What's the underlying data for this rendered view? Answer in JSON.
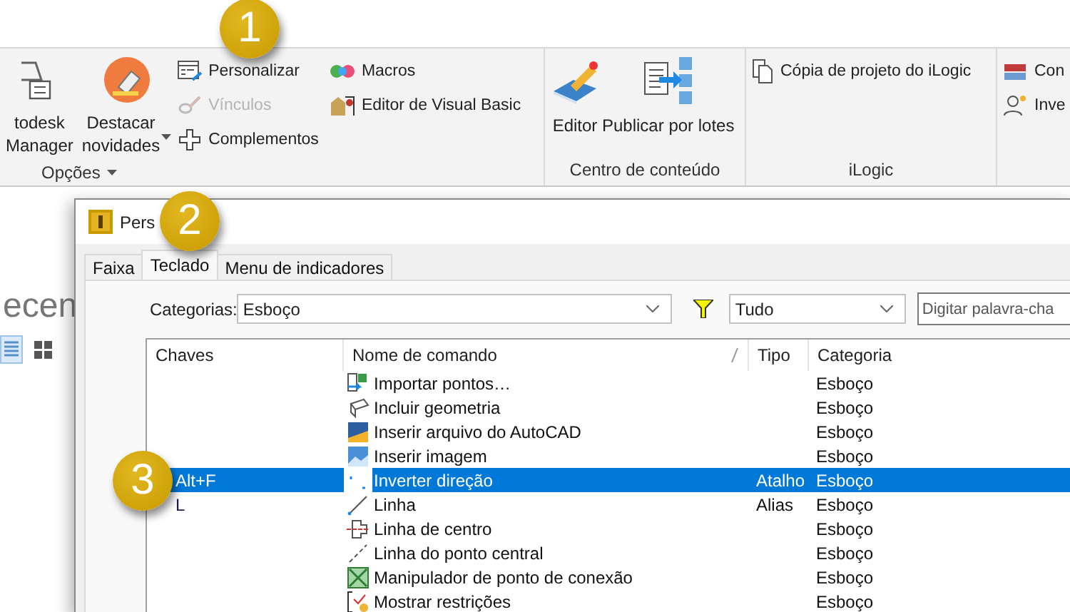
{
  "callouts": [
    {
      "label": "1"
    },
    {
      "label": "2"
    },
    {
      "label": "3"
    }
  ],
  "ribbon": {
    "panels": [
      {
        "title": "Opções",
        "has_menu": true,
        "items": [
          {
            "kind": "large",
            "label": "todesk\nManager",
            "dropdown": false
          },
          {
            "kind": "large",
            "label": "Destacar\nnovidades",
            "dropdown": true
          },
          {
            "kind": "small",
            "label": "Personalizar",
            "disabled": false
          },
          {
            "kind": "small",
            "label": "Vínculos",
            "disabled": true
          },
          {
            "kind": "small",
            "label": "Complementos",
            "disabled": false
          },
          {
            "kind": "small",
            "label": "Macros",
            "disabled": false
          },
          {
            "kind": "small",
            "label": "Editor de Visual Basic",
            "disabled": false
          }
        ]
      },
      {
        "title": "Centro de conteúdo",
        "has_menu": false,
        "items": [
          {
            "kind": "large",
            "label": "Editor",
            "dropdown": false
          },
          {
            "kind": "large",
            "label": "Publicar por lotes",
            "dropdown": false
          }
        ]
      },
      {
        "title": "iLogic",
        "has_menu": false,
        "items": [
          {
            "kind": "small",
            "label": "Cópia de projeto do iLogic",
            "disabled": false
          }
        ]
      },
      {
        "has_menu": false,
        "items": [
          {
            "kind": "small",
            "label": "Con",
            "disabled": false
          },
          {
            "kind": "small",
            "label": "Inve",
            "disabled": false
          }
        ]
      }
    ]
  },
  "background": {
    "heading": "ecen",
    "views": [
      {
        "selected": true
      },
      {
        "selected": false
      }
    ]
  },
  "dialog": {
    "title": "Pers",
    "tabs": [
      {
        "label": "Faixa",
        "selected": false
      },
      {
        "label": "Teclado",
        "selected": true
      },
      {
        "label": "Menu de indicadores",
        "selected": false
      }
    ],
    "category_label": "Categorias:",
    "category_value": "Esboço",
    "type_value": "Tudo",
    "search_placeholder": "Digitar palavra-cha",
    "table": {
      "columns": [
        "Chaves",
        "Nome de comando",
        "Tipo",
        "Categoria"
      ],
      "rows": [
        {
          "name": "Importar pontos…",
          "category": "Esboço",
          "selected": false
        },
        {
          "name": "Incluir geometria",
          "category": "Esboço",
          "selected": false
        },
        {
          "name": "Inserir arquivo do AutoCAD",
          "category": "Esboço",
          "selected": false
        },
        {
          "name": "Inserir imagem",
          "category": "Esboço",
          "selected": false
        },
        {
          "keys": "Alt+F",
          "name": "Inverter direção",
          "type": "Atalho",
          "category": "Esboço",
          "selected": true
        },
        {
          "keys": "L",
          "name": "Linha",
          "type": "Alias",
          "category": "Esboço",
          "selected": false
        },
        {
          "name": "Linha de centro",
          "category": "Esboço",
          "selected": false
        },
        {
          "name": "Linha do ponto central",
          "category": "Esboço",
          "selected": false
        },
        {
          "name": "Manipulador de ponto de conexão",
          "category": "Esboço",
          "selected": false
        },
        {
          "name": "Mostrar restrições",
          "category": "Esboço",
          "selected": false
        }
      ]
    }
  }
}
